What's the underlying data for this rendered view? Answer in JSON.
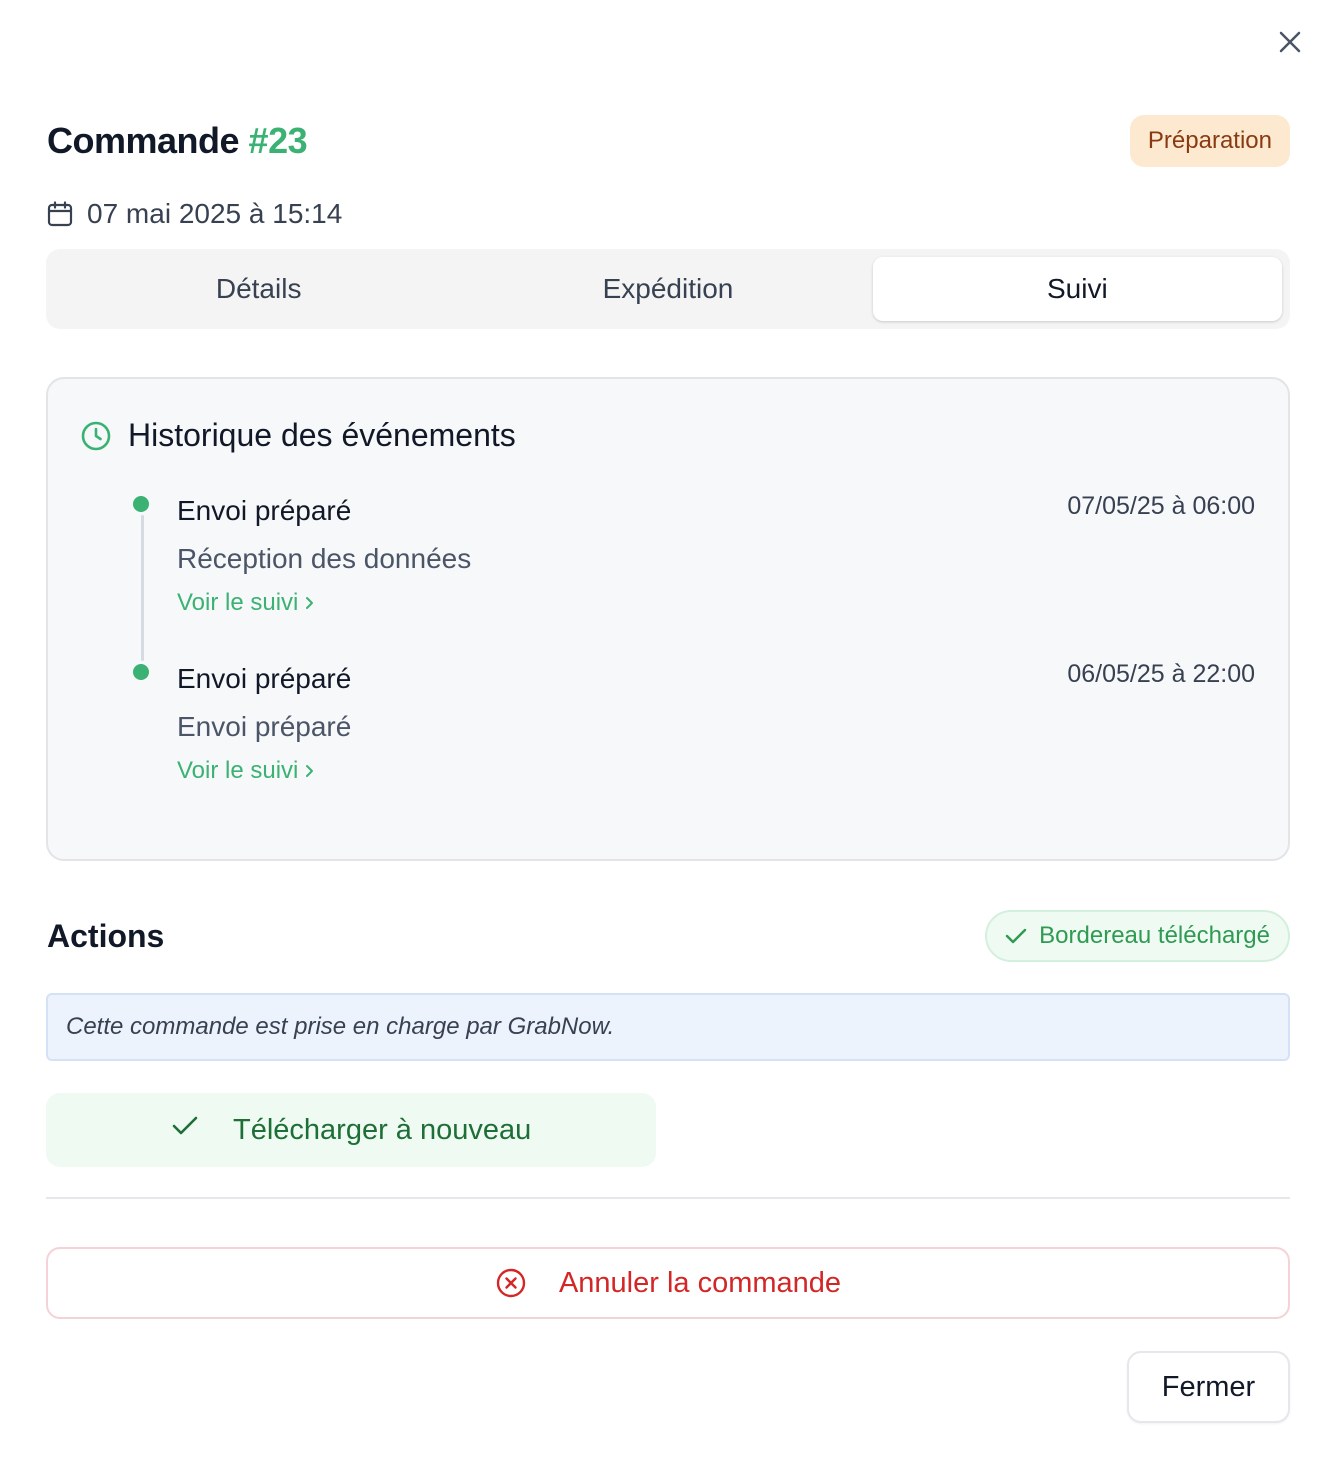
{
  "order": {
    "title_prefix": "Commande",
    "number": "#23",
    "status": "Préparation",
    "date": "07 mai 2025 à 15:14"
  },
  "tabs": [
    {
      "label": "Détails",
      "active": false
    },
    {
      "label": "Expédition",
      "active": false
    },
    {
      "label": "Suivi",
      "active": true
    }
  ],
  "history": {
    "title": "Historique des événements",
    "events": [
      {
        "title": "Envoi préparé",
        "subtitle": "Réception des données",
        "link": "Voir le suivi",
        "date": "07/05/25 à 06:00"
      },
      {
        "title": "Envoi préparé",
        "subtitle": "Envoi préparé",
        "link": "Voir le suivi",
        "date": "06/05/25 à 22:00"
      }
    ]
  },
  "actions": {
    "title": "Actions",
    "badge": "Bordereau téléchargé",
    "info": "Cette commande est prise en charge par GrabNow.",
    "redownload_label": "Télécharger à nouveau",
    "cancel_label": "Annuler la commande"
  },
  "footer": {
    "close_label": "Fermer"
  },
  "colors": {
    "accent_green": "#3bb273",
    "danger_red": "#d32626",
    "status_bg": "#fde9cf"
  },
  "icons": {
    "close": "close-icon",
    "date": "calendar-icon",
    "history": "clock-icon",
    "check": "check-icon",
    "cancel": "x-circle-icon"
  }
}
